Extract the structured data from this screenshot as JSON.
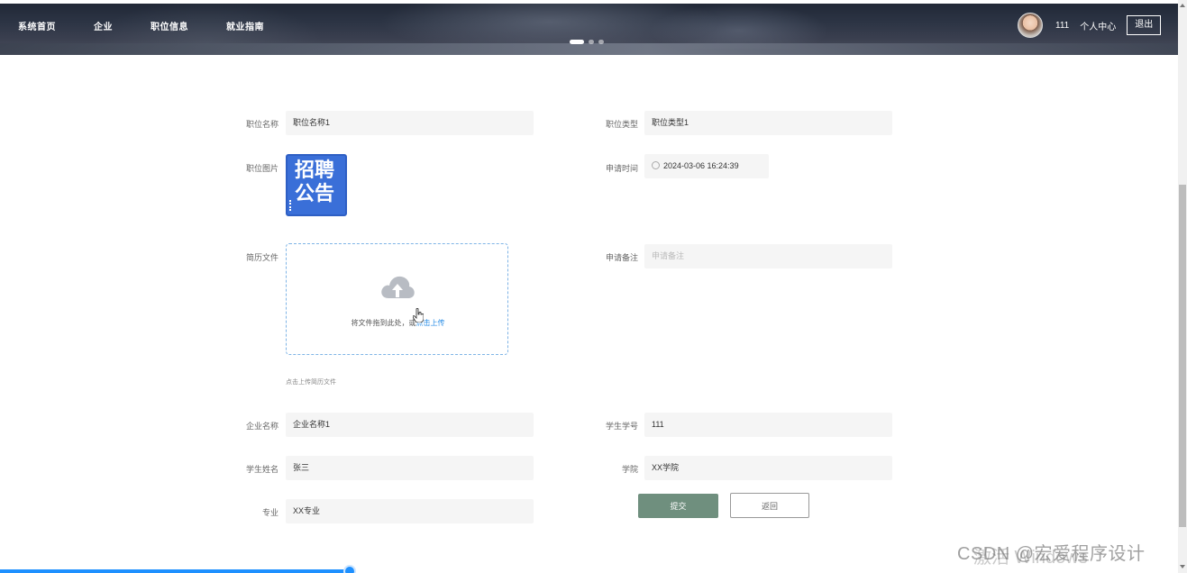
{
  "nav": {
    "items": [
      "系统首页",
      "企业",
      "职位信息",
      "就业指南"
    ]
  },
  "user": {
    "name": "111",
    "center_label": "个人中心",
    "logout_label": "退出"
  },
  "form": {
    "job_name": {
      "label": "职位名称",
      "value": "职位名称1"
    },
    "job_type": {
      "label": "职位类型",
      "value": "职位类型1"
    },
    "job_image": {
      "label": "职位图片",
      "line1": "招聘",
      "line2": "公告"
    },
    "apply_time": {
      "label": "申请时间",
      "value": "2024-03-06 16:24:39"
    },
    "resume": {
      "label": "简历文件",
      "drop_text": "将文件拖到此处，或",
      "click_text": "点击上传",
      "hint": "点击上传简历文件"
    },
    "apply_note": {
      "label": "申请备注",
      "placeholder": "申请备注"
    },
    "company_name": {
      "label": "企业名称",
      "value": "企业名称1"
    },
    "student_id": {
      "label": "学生学号",
      "value": "111"
    },
    "student_name": {
      "label": "学生姓名",
      "value": "张三"
    },
    "college": {
      "label": "学院",
      "value": "XX学院"
    },
    "major": {
      "label": "专业",
      "value": "XX专业"
    }
  },
  "buttons": {
    "submit": "提交",
    "back": "返回"
  },
  "watermark": {
    "csdn": "CSDN @宏爱程序设计",
    "activate": "激活 Windows"
  },
  "colors": {
    "submit_bg": "#6f8f7e",
    "link": "#2b8ee6",
    "upload_border": "#7eb4e6"
  }
}
